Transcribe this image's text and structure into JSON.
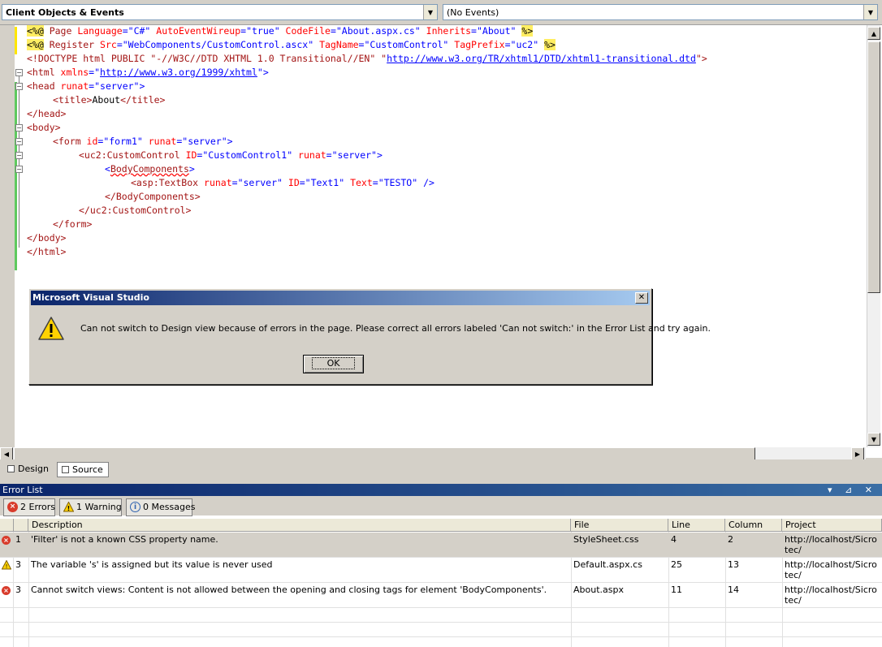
{
  "toolbar": {
    "objects_combo": "Client Objects & Events",
    "events_combo": "(No Events)"
  },
  "code_lines": {
    "l1": {
      "dir_open": "<%@",
      "t1": " Page ",
      "a1": "Language",
      "eq1": "=",
      "v1": "\"C#\"",
      "a2": " AutoEventWireup",
      "v2": "\"true\"",
      "a3": " CodeFile",
      "v3": "\"About.aspx.cs\"",
      "a4": " Inherits",
      "v4": "\"About\"",
      "dir_close": "%>"
    },
    "l2": {
      "dir_open": "<%@",
      "t1": " Register ",
      "a1": "Src",
      "v1": "\"WebComponents/CustomControl.ascx\"",
      "a2": " TagName",
      "v2": "\"CustomControl\"",
      "a3": " TagPrefix",
      "v3": "\"uc2\"",
      "dir_close": "%>"
    },
    "l3": {
      "pre": "<!DOCTYPE html PUBLIC \"-//W3C//DTD XHTML 1.0 Transitional//EN\" \"",
      "link": "http://www.w3.org/TR/xhtml1/DTD/xhtml1-transitional.dtd",
      "post": "\">"
    },
    "l4": {
      "pre": "<html ",
      "attr": "xmlns",
      "eq": "=\"",
      "link": "http://www.w3.org/1999/xhtml",
      "post": "\">"
    },
    "l5": {
      "tag": "<head ",
      "attr": "runat",
      "val": "=\"server\">"
    },
    "l6": {
      "tag": "<title>",
      "text": "About",
      "close": "</title>"
    },
    "l7": "</head>",
    "l8": "<body>",
    "l9": {
      "tag": "<form ",
      "a1": "id",
      "v1": "=\"form1\" ",
      "a2": "runat",
      "v2": "=\"server\">"
    },
    "l10": {
      "tag": "<uc2:CustomControl ",
      "a1": "ID",
      "v1": "=\"CustomControl1\" ",
      "a2": "runat",
      "v2": "=\"server\">"
    },
    "l11": {
      "lt": "<",
      "name": "BodyComponents",
      "gt": ">"
    },
    "l12": {
      "tag": "<asp:TextBox ",
      "a1": "runat",
      "v1": "=\"server\" ",
      "a2": "ID",
      "v2": "=\"Text1\" ",
      "a3": "Text",
      "v3": "=\"TESTO\" ",
      "close": "/>"
    },
    "l13": "</BodyComponents>",
    "l14": "</uc2:CustomControl>",
    "l15": "</form>",
    "l16": "</body>",
    "l17": "</html>"
  },
  "view_tabs": {
    "design": "Design",
    "source": "Source"
  },
  "dialog": {
    "title": "Microsoft Visual Studio",
    "close": "✕",
    "message": "Can not switch to Design view because of errors in the page. Please correct all errors labeled 'Can not switch:' in the Error List and try again.",
    "ok": "OK"
  },
  "error_list": {
    "title": "Error List",
    "controls": "▾ ⊿ ✕",
    "errors_btn": "2 Errors",
    "warnings_btn": "1 Warning",
    "messages_btn": "0 Messages",
    "columns": {
      "description": "Description",
      "file": "File",
      "line": "Line",
      "column": "Column",
      "project": "Project"
    },
    "rows": [
      {
        "num": "1",
        "type": "error",
        "description": "'Filter' is not a known CSS property name.",
        "file": "StyleSheet.css",
        "line": "4",
        "column": "2",
        "project": "http://localhost/Sicrotec/"
      },
      {
        "num": "3",
        "type": "warning",
        "description": "The variable 's' is assigned but its value is never used",
        "file": "Default.aspx.cs",
        "line": "25",
        "column": "13",
        "project": "http://localhost/Sicrotec/"
      },
      {
        "num": "3",
        "type": "error",
        "description": "Cannot switch views: Content is not allowed between the opening and closing tags for element 'BodyComponents'.",
        "file": "About.aspx",
        "line": "11",
        "column": "14",
        "project": "http://localhost/Sicrotec/"
      }
    ]
  },
  "colors": {
    "title_bar": "#0a246a",
    "error_icon": "#d83b2b",
    "warning_icon": "#ffd200",
    "change_bar": "#5ec95e"
  }
}
